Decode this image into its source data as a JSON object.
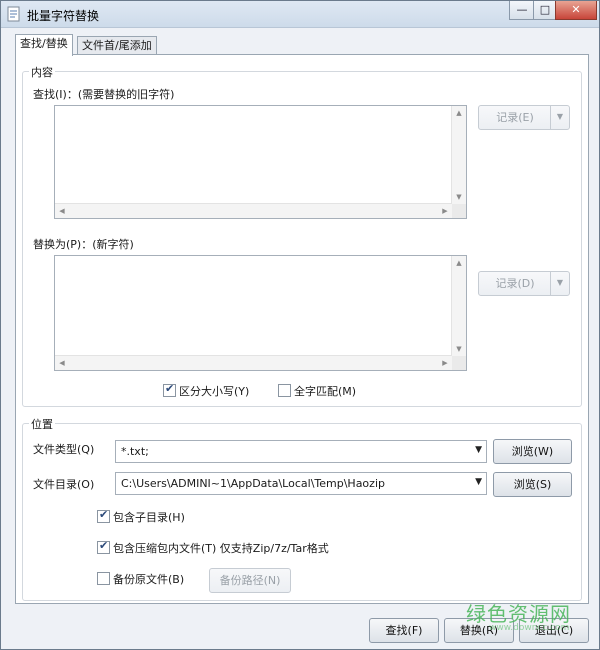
{
  "window": {
    "title": "批量字符替换",
    "controls": {
      "minimize": "—",
      "maximize": "□",
      "close": "✕"
    }
  },
  "tabs": [
    {
      "label": "查找/替换",
      "active": true
    },
    {
      "label": "文件首/尾添加",
      "active": false
    }
  ],
  "content_group": {
    "title": "内容",
    "find_label": "查找(I)：(需要替换的旧字符)",
    "find_value": "",
    "find_history_button": "记录(E)",
    "replace_label": "替换为(P)：(新字符)",
    "replace_value": "",
    "replace_history_button": "记录(D)",
    "case_sensitive": {
      "label": "区分大小写(Y)",
      "checked": true
    },
    "whole_word": {
      "label": "全字匹配(M)",
      "checked": false
    }
  },
  "location_group": {
    "title": "位置",
    "file_type_label": "文件类型(Q)",
    "file_type_value": "*.txt;",
    "file_type_browse": "浏览(W)",
    "directory_label": "文件目录(O)",
    "directory_value": "C:\\Users\\ADMINI~1\\AppData\\Local\\Temp\\Haozip",
    "directory_browse": "浏览(S)",
    "include_subdirs": {
      "label": "包含子目录(H)",
      "checked": true
    },
    "include_archives": {
      "label": "包含压缩包内文件(T) 仅支持Zip/7z/Tar格式",
      "checked": true
    },
    "backup_files": {
      "label": "备份原文件(B)",
      "checked": false
    },
    "backup_path_button": "备份路径(N)"
  },
  "footer": {
    "find_button": "查找(F)",
    "replace_button": "替换(R)",
    "exit_button": "退出(C)"
  },
  "watermark": {
    "text": "绿色资源网",
    "sub": "www.downcc.com"
  },
  "colors": {
    "title_bar": "#cddbea",
    "watermark": "#49b65a",
    "accent": "#2c4a7a"
  }
}
